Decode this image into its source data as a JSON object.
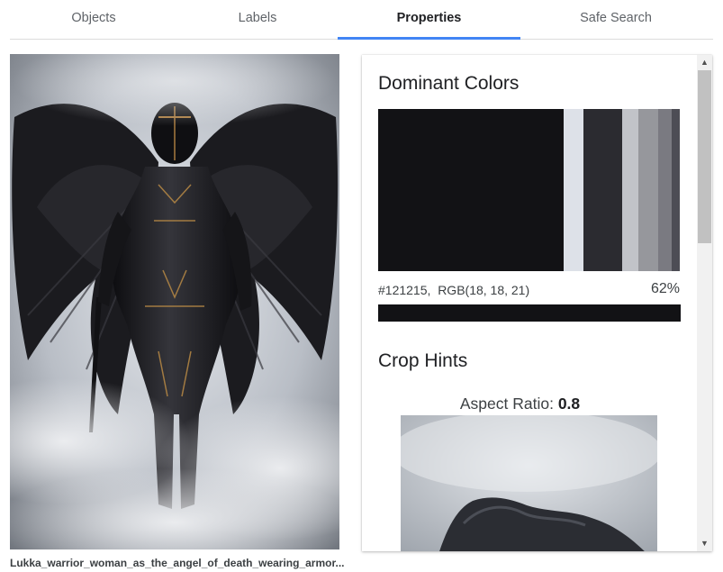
{
  "tabs": [
    {
      "label": "Objects"
    },
    {
      "label": "Labels"
    },
    {
      "label": "Properties"
    },
    {
      "label": "Safe Search"
    }
  ],
  "active_tab": "Properties",
  "image": {
    "caption": "Lukka_warrior_woman_as_the_angel_of_death_wearing_armor..."
  },
  "properties": {
    "dominant_colors_title": "Dominant Colors",
    "swatches": [
      {
        "color": "#121215",
        "weight": 62
      },
      {
        "color": "#dde1e8",
        "weight": 6.5
      },
      {
        "color": "#2b2b30",
        "weight": 13
      },
      {
        "color": "#c1c3c8",
        "weight": 5.5
      },
      {
        "color": "#96979c",
        "weight": 6.5
      },
      {
        "color": "#7a7a81",
        "weight": 4.5
      },
      {
        "color": "#4d4d55",
        "weight": 2.7
      }
    ],
    "selected_color": {
      "hex": "#121215,",
      "rgb": "RGB(18, 18, 21)",
      "percent": "62%",
      "color": "#121215"
    },
    "crop_hints_title": "Crop Hints",
    "aspect_label": "Aspect Ratio:",
    "aspect_value": "0.8"
  },
  "scrollbar": {
    "up_icon": "▲",
    "down_icon": "▼"
  }
}
